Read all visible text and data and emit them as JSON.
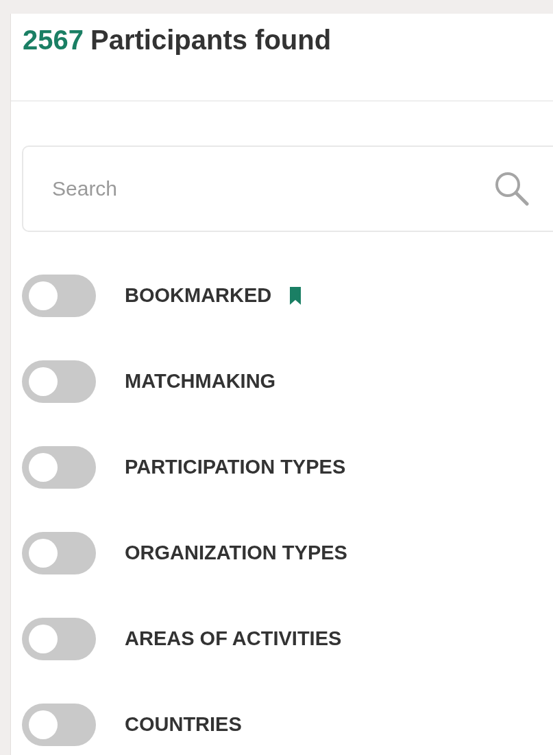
{
  "header": {
    "count": "2567",
    "label": "Participants found"
  },
  "search": {
    "placeholder": "Search"
  },
  "filters": [
    {
      "kind": "bookmark",
      "label": "BOOKMARKED",
      "on": false
    },
    {
      "kind": "plain",
      "label": "MATCHMAKING",
      "on": false
    },
    {
      "kind": "plain",
      "label": "PARTICIPATION TYPES",
      "on": false
    },
    {
      "kind": "plain",
      "label": "ORGANIZATION TYPES",
      "on": false
    },
    {
      "kind": "plain",
      "label": "AREAS OF ACTIVITIES",
      "on": false
    },
    {
      "kind": "plain",
      "label": "COUNTRIES",
      "on": false
    }
  ]
}
